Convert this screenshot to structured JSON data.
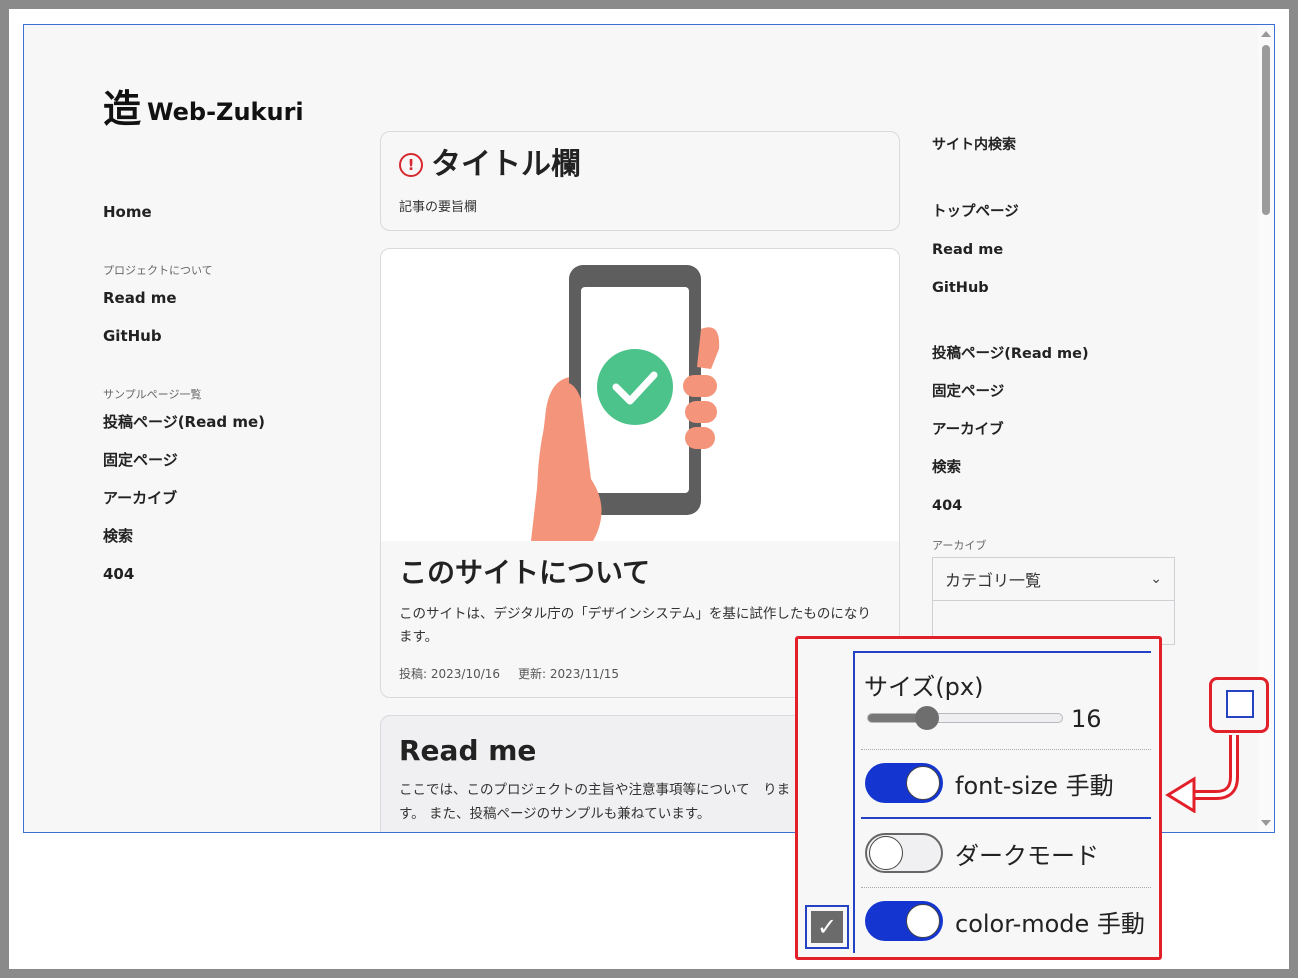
{
  "site": {
    "logo_mark": "造",
    "logo_text": "Web-Zukuri"
  },
  "left_nav": {
    "home": "Home",
    "project_caption": "プロジェクトについて",
    "project_items": [
      "Read me",
      "GitHub"
    ],
    "samples_caption": "サンプルページ一覧",
    "sample_items": [
      "投稿ページ(Read me)",
      "固定ページ",
      "アーカイブ",
      "検索",
      "404"
    ]
  },
  "title_card": {
    "icon": "alert-icon",
    "title": "タイトル欄",
    "summary": "記事の要旨欄"
  },
  "about_card": {
    "title": "このサイトについて",
    "description": "このサイトは、デジタル庁の「デザインシステム」を基に試作したものになります。",
    "posted": "投稿: 2023/10/16",
    "updated": "更新: 2023/11/15"
  },
  "readme_card": {
    "title": "Read me",
    "description": "ここでは、このプロジェクトの主旨や注意事項等について　ります。 また、投稿ページのサンプルも兼ねています。"
  },
  "right_nav": {
    "search_label": "サイト内検索",
    "top_items": [
      "トップページ",
      "Read me",
      "GitHub"
    ],
    "sample_items": [
      "投稿ページ(Read me)",
      "固定ページ",
      "アーカイブ",
      "検索",
      "404"
    ],
    "archive_caption": "アーカイブ",
    "category_select": "カテゴリ一覧"
  },
  "settings_panel": {
    "size_label": "サイズ(px)",
    "size_value": "16",
    "font_size_slider_fraction": 0.3,
    "font_size_manual_label": "font-size 手動",
    "font_size_manual_on": true,
    "dark_mode_label": "ダークモード",
    "dark_mode_on": false,
    "color_mode_manual_label": "color-mode 手動",
    "color_mode_manual_on": true,
    "checkbox_icon": "check-icon"
  },
  "colors": {
    "accent_blue": "#1435cf",
    "highlight_red": "#e2202a",
    "alert_red": "#d8282f",
    "success_green": "#4cc38a"
  }
}
